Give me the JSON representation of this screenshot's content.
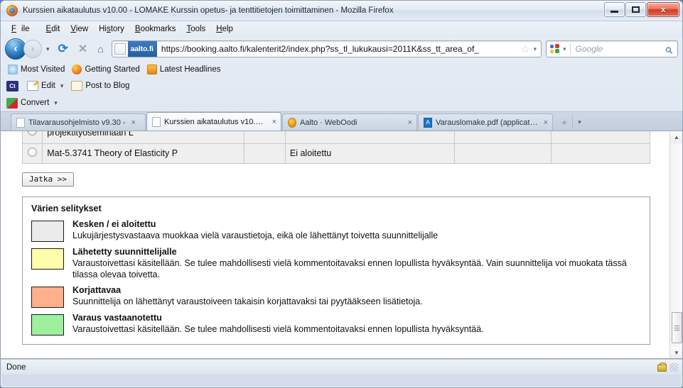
{
  "window": {
    "title": "Kurssien aikataulutus v10.00 - LOMAKE Kurssin opetus- ja tenttitietojen toimittaminen - Mozilla Firefox",
    "logo_icon": "firefox-icon",
    "controls": {
      "minimize_icon": "minimize-icon",
      "maximize_icon": "maximize-icon",
      "close_label": "x",
      "close_icon": "close-icon"
    }
  },
  "menubar": {
    "items": [
      {
        "label": "File"
      },
      {
        "label": "Edit"
      },
      {
        "label": "View"
      },
      {
        "label": "History"
      },
      {
        "label": "Bookmarks"
      },
      {
        "label": "Tools"
      },
      {
        "label": "Help"
      }
    ]
  },
  "navbar": {
    "back_icon": "back-arrow-icon",
    "back_label": "‹",
    "forward_icon": "forward-arrow-icon",
    "forward_label": "›",
    "history_caret": "▾",
    "reload_icon": "reload-icon",
    "reload_label": "⟳",
    "stop_icon": "stop-icon",
    "stop_label": "✕",
    "home_icon": "home-icon",
    "home_label": "⌂",
    "url": {
      "site_identity": "aalto.fi",
      "value": "https://booking.aalto.fi/kalenterit2/index.php?ss_tl_lukukausi=2011K&ss_tt_area_of_",
      "favicon": "page-icon",
      "bookmark_star_icon": "star-icon",
      "bookmark_star_label": "☆",
      "dropdown_caret": "▾"
    },
    "search": {
      "engine_icon": "google-icon",
      "engine_caret": "▾",
      "placeholder": "Google",
      "value": "",
      "search_icon": "magnifier-icon",
      "search_label": "⚲"
    }
  },
  "bookmarks_toolbar": {
    "items": [
      {
        "label": "Most Visited",
        "icon": "most-visited-icon"
      },
      {
        "label": "Getting Started",
        "icon": "firefox-icon"
      },
      {
        "label": "Latest Headlines",
        "icon": "rss-feed-icon"
      }
    ]
  },
  "addon_toolbars": [
    {
      "badge": "Ct",
      "badge_icon": "ct-addon-icon",
      "items": [
        {
          "label": "Edit",
          "icon": "edit-pencil-icon",
          "caret": "▾"
        },
        {
          "label": "Post to Blog",
          "icon": "blog-post-icon",
          "caret": ""
        }
      ]
    },
    {
      "badge": "",
      "items": [
        {
          "label": "Convert",
          "icon": "convert-pdf-icon",
          "caret": "▾"
        }
      ]
    }
  ],
  "tabs": {
    "items": [
      {
        "label": "Tilavarausohjelmisto v9.30 -",
        "icon": "page-icon",
        "active": false,
        "close_label": "×"
      },
      {
        "label": "Kurssien aikataulutus v10.00...",
        "icon": "page-icon",
        "active": true,
        "close_label": "×"
      },
      {
        "label": "Aalto · WebOodi",
        "icon": "firefox-icon",
        "active": false,
        "close_label": "×"
      },
      {
        "label": "Varauslomake.pdf (application...",
        "icon": "pdf-icon",
        "icon_text": "A",
        "active": false,
        "close_label": "×"
      }
    ],
    "new_tab_label": "+",
    "new_tab_icon": "new-tab-icon",
    "list_all_label": "▾",
    "list_all_icon": "list-all-tabs-icon"
  },
  "page": {
    "table": {
      "rows": [
        {
          "radio_icon": "radio-button-icon",
          "name": "projektityöseminaari L",
          "blank1": "",
          "status": "",
          "blank2": "",
          "blank3": "",
          "partial": true
        },
        {
          "radio_icon": "radio-button-icon",
          "name": "Mat-5.3741 Theory of Elasticity P",
          "blank1": "",
          "status": "Ei aloitettu",
          "blank2": "",
          "blank3": "",
          "partial": false
        }
      ]
    },
    "continue_button": "Jatka >>",
    "legend": {
      "title": "Värien selitykset",
      "entries": [
        {
          "color": "#ebebeb",
          "heading": "Kesken / ei aloitettu",
          "description": "Lukujärjestysvastaava muokkaa vielä varaustietoja, eikä ole lähettänyt toivetta suunnittelijalle"
        },
        {
          "color": "#fdfdaa",
          "heading": "Lähetetty suunnittelijalle",
          "description": "Varaustoivettasi käsitellään. Se tulee mahdollisesti vielä kommentoitavaksi ennen lopullista hyväksyntää. Vain suunnittelija voi muokata tässä tilassa olevaa toivetta."
        },
        {
          "color": "#ffb08a",
          "heading": "Korjattavaa",
          "description": "Suunnittelija on lähettänyt varaustoiveen takaisin korjattavaksi tai pyytääkseen lisätietoja."
        },
        {
          "color": "#9ef09e",
          "heading": "Varaus vastaanotettu",
          "description": "Varaustoivettasi käsitellään. Se tulee mahdollisesti vielä kommentoitavaksi ennen lopullista hyväksyntää."
        }
      ]
    },
    "scrollbar": {
      "up_label": "▲",
      "down_label": "▼",
      "up_icon": "scroll-up-icon",
      "down_icon": "scroll-down-icon"
    }
  },
  "statusbar": {
    "text": "Done",
    "lock_icon": "secure-lock-icon",
    "resize_grip_icon": "resize-grip-icon"
  },
  "colors": {
    "accent": "#215f9f",
    "close_button": "#cf3b26",
    "legend_border": "#9e9e9e"
  }
}
